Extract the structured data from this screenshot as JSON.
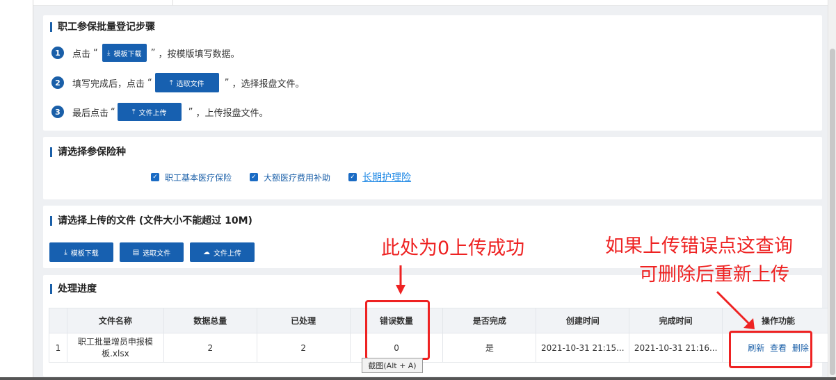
{
  "steps_panel": {
    "title": "职工参保批量登记步骤",
    "steps": [
      {
        "num": "1",
        "prefix": "点击",
        "button": "模板下载",
        "suffix": "，按模版填写数据。"
      },
      {
        "num": "2",
        "prefix": "填写完成后，点击",
        "button": "选取文件",
        "suffix": "，选择报盘文件。"
      },
      {
        "num": "3",
        "prefix": "最后点击",
        "button": "文件上传",
        "suffix": "，上传报盘文件。"
      }
    ],
    "quote_open": "“",
    "quote_close": "”"
  },
  "insurance_panel": {
    "title": "请选择参保险种",
    "options": [
      "职工基本医疗保险",
      "大额医疗费用补助",
      "长期护理险"
    ]
  },
  "upload_panel": {
    "title": "请选择上传的文件 (文件大小不能超过 10M)",
    "buttons": [
      "模板下载",
      "选取文件",
      "文件上传"
    ]
  },
  "progress_panel": {
    "title": "处理进度",
    "columns": [
      "",
      "文件名称",
      "数据总量",
      "已处理",
      "错误数量",
      "是否完成",
      "创建时间",
      "完成时间",
      "操作功能"
    ],
    "rows": [
      {
        "index": "1",
        "file_name": "职工批量增员申报模板.xlsx",
        "total": "2",
        "processed": "2",
        "errors": "0",
        "completed": "是",
        "created": "2021-10-31 21:15...",
        "finished": "2021-10-31 21:16...",
        "actions": [
          "刷新",
          "查看",
          "删除"
        ]
      }
    ]
  },
  "annotations": {
    "success_note": "此处为0上传成功",
    "error_note_line1": "如果上传错误点这查询",
    "error_note_line2": "可删除后重新上传"
  },
  "tooltip": "截图(Alt + A)",
  "colors": {
    "primary": "#1760b0",
    "annotation": "#ee2222"
  }
}
